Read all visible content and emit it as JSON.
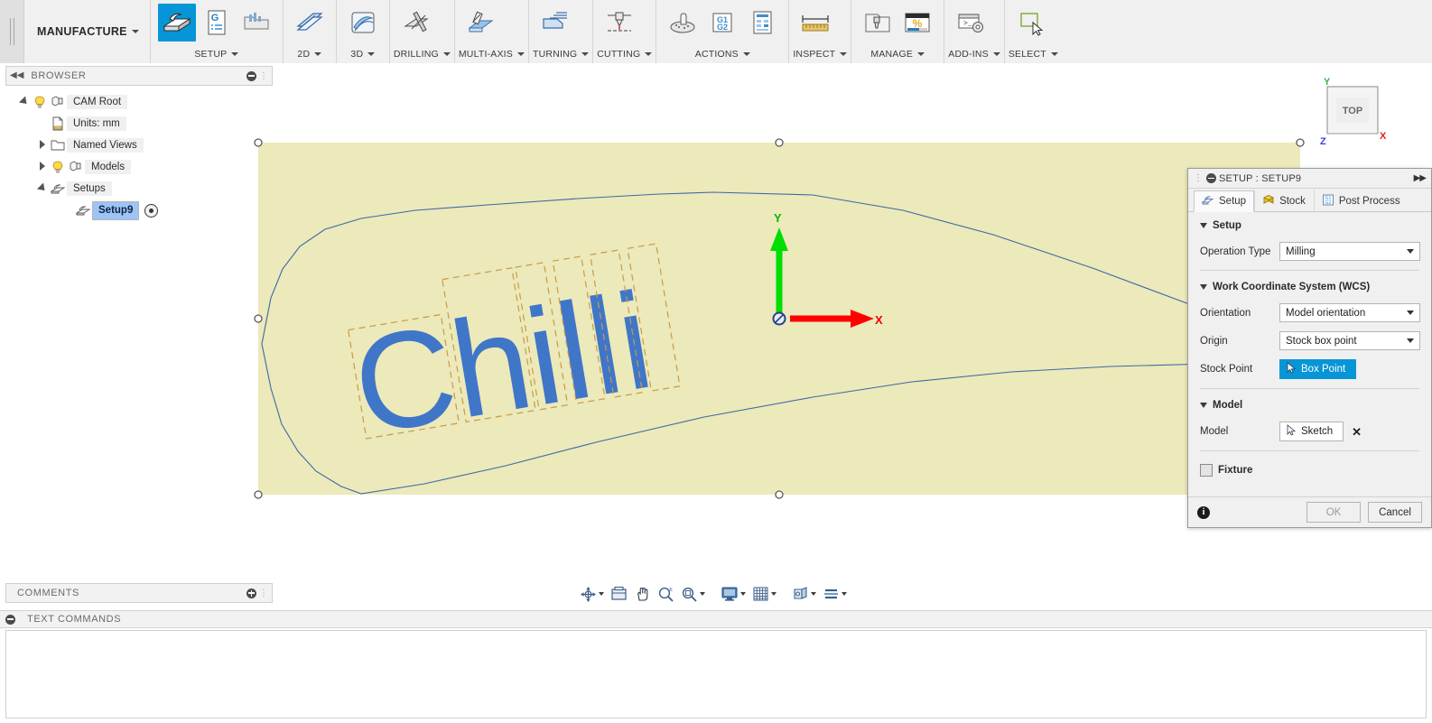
{
  "ribbon": {
    "workspace": "MANUFACTURE",
    "groups": [
      {
        "title": "SETUP",
        "icons": [
          "setup-icon",
          "generate-nc-icon",
          "folder-setup-icon"
        ]
      },
      {
        "title": "2D",
        "icons": [
          "2d-milling-icon"
        ]
      },
      {
        "title": "3D",
        "icons": [
          "3d-milling-icon"
        ]
      },
      {
        "title": "DRILLING",
        "icons": [
          "drilling-icon"
        ]
      },
      {
        "title": "MULTI-AXIS",
        "icons": [
          "multi-axis-icon"
        ]
      },
      {
        "title": "TURNING",
        "icons": [
          "turning-icon"
        ]
      },
      {
        "title": "CUTTING",
        "icons": [
          "cutting-icon"
        ]
      },
      {
        "title": "ACTIONS",
        "icons": [
          "simulate-icon",
          "g-code-icon",
          "setup-sheet-icon"
        ]
      },
      {
        "title": "INSPECT",
        "icons": [
          "measure-icon"
        ]
      },
      {
        "title": "MANAGE",
        "icons": [
          "tool-library-icon",
          "machining-time-icon"
        ]
      },
      {
        "title": "ADD-INS",
        "icons": [
          "scripts-addins-icon"
        ]
      },
      {
        "title": "SELECT",
        "icons": [
          "select-icon"
        ]
      }
    ]
  },
  "browser": {
    "title": "BROWSER",
    "collapse_icon": "collapse-left-icon",
    "minimize_icon": "minus-circle-icon",
    "tree": [
      {
        "label": "CAM Root",
        "indent": 0,
        "twisty": "expanded",
        "icons": [
          "lightbulb-icon",
          "body-icon"
        ],
        "selected": false
      },
      {
        "label": "Units: mm",
        "indent": 1,
        "twisty": "none",
        "icons": [
          "document-ruler-icon"
        ],
        "selected": false
      },
      {
        "label": "Named Views",
        "indent": 1,
        "twisty": "collapsed",
        "icons": [
          "folder-icon"
        ],
        "selected": false
      },
      {
        "label": "Models",
        "indent": 1,
        "twisty": "collapsed",
        "icons": [
          "lightbulb-icon",
          "body-icon"
        ],
        "selected": false
      },
      {
        "label": "Setups",
        "indent": 1,
        "twisty": "expanded",
        "icons": [
          "setup-icon"
        ],
        "selected": false
      },
      {
        "label": "Setup9",
        "indent": 2,
        "twisty": "none",
        "icons": [
          "setup-icon"
        ],
        "selected": true,
        "radio": true
      }
    ]
  },
  "viewcube": {
    "face_label": "TOP",
    "axis_x": "X",
    "axis_y": "Y",
    "axis_z": "Z",
    "color_x": "#e02020",
    "color_y": "#3cb44b",
    "color_z": "#4141d8"
  },
  "canvas": {
    "stock_fill": "#ece9ba",
    "model_outline": "#3f68a8",
    "sketch_text": "Chilli",
    "sketch_fill": "#3f76c8",
    "sketch_box_stroke": "#c89b46",
    "wcs": {
      "x_label": "X",
      "y_label": "Y",
      "x_color": "#ff0000",
      "y_color": "#00dd00",
      "origin_icon": "wcs-origin-icon"
    },
    "handles": 6
  },
  "comments": {
    "title": "COMMENTS",
    "add_icon": "plus-circle-icon"
  },
  "text_commands": {
    "title": "TEXT COMMANDS",
    "minimize_icon": "minus-circle-icon",
    "content": ""
  },
  "navbar": {
    "items": [
      {
        "name": "orbit-icon",
        "caret": true
      },
      {
        "name": "look-at-icon",
        "caret": false
      },
      {
        "name": "pan-icon",
        "caret": false
      },
      {
        "name": "zoom-icon",
        "caret": false
      },
      {
        "name": "zoom-window-icon",
        "caret": true
      },
      {
        "name": "display-settings-icon",
        "caret": true
      },
      {
        "name": "grid-snaps-icon",
        "caret": true
      },
      {
        "name": "viewports-icon",
        "caret": true
      },
      {
        "name": "layout-grid-icon",
        "caret": true
      }
    ]
  },
  "dialog": {
    "title": "SETUP : SETUP9",
    "minimize_icon": "minus-circle-icon",
    "expand_icon": "double-chevron-right-icon",
    "tabs": [
      {
        "label": "Setup",
        "icon": "setup-tab-icon",
        "active": true
      },
      {
        "label": "Stock",
        "icon": "stock-cube-icon",
        "active": false
      },
      {
        "label": "Post Process",
        "icon": "post-process-icon",
        "active": false
      }
    ],
    "sections": {
      "setup": {
        "heading": "Setup",
        "operation_type": {
          "label": "Operation Type",
          "value": "Milling"
        }
      },
      "wcs": {
        "heading": "Work Coordinate System (WCS)",
        "orientation": {
          "label": "Orientation",
          "value": "Model orientation"
        },
        "origin": {
          "label": "Origin",
          "value": "Stock box point"
        },
        "stock_point": {
          "label": "Stock Point",
          "button": "Box Point",
          "icon": "cursor-icon"
        }
      },
      "model": {
        "heading": "Model",
        "model": {
          "label": "Model",
          "button": "Sketch",
          "icon": "cursor-icon",
          "clear": "✕"
        }
      },
      "fixture": {
        "heading": "Fixture",
        "checked": false
      }
    },
    "footer": {
      "info_icon": "info-icon",
      "info_glyph": "i",
      "ok": "OK",
      "cancel": "Cancel"
    },
    "accent_color": "#0696d7"
  }
}
